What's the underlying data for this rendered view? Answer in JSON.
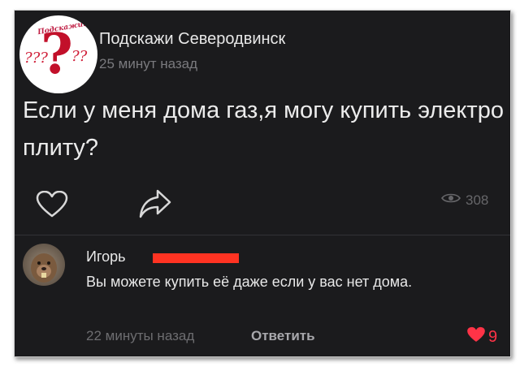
{
  "post": {
    "group_name": "Подскажи Северодвинск",
    "time": "25 минут назад",
    "text": "Если у меня дома газ,я могу купить электро плиту?",
    "views": "308",
    "avatar_lettering": "Подскажите"
  },
  "comment": {
    "author": "Игорь",
    "text": "Вы можете купить её даже если у вас нет дома.",
    "time": "22 минуты назад",
    "reply_label": "Ответить",
    "likes": "9"
  },
  "colors": {
    "background": "#1b1b1d",
    "text": "#e8e8e8",
    "muted": "#7a7a7e",
    "like_red": "#ff3347",
    "redaction": "#ff3322"
  },
  "icons": [
    "heart-icon",
    "share-arrow-icon",
    "eye-icon",
    "heart-filled-icon"
  ]
}
